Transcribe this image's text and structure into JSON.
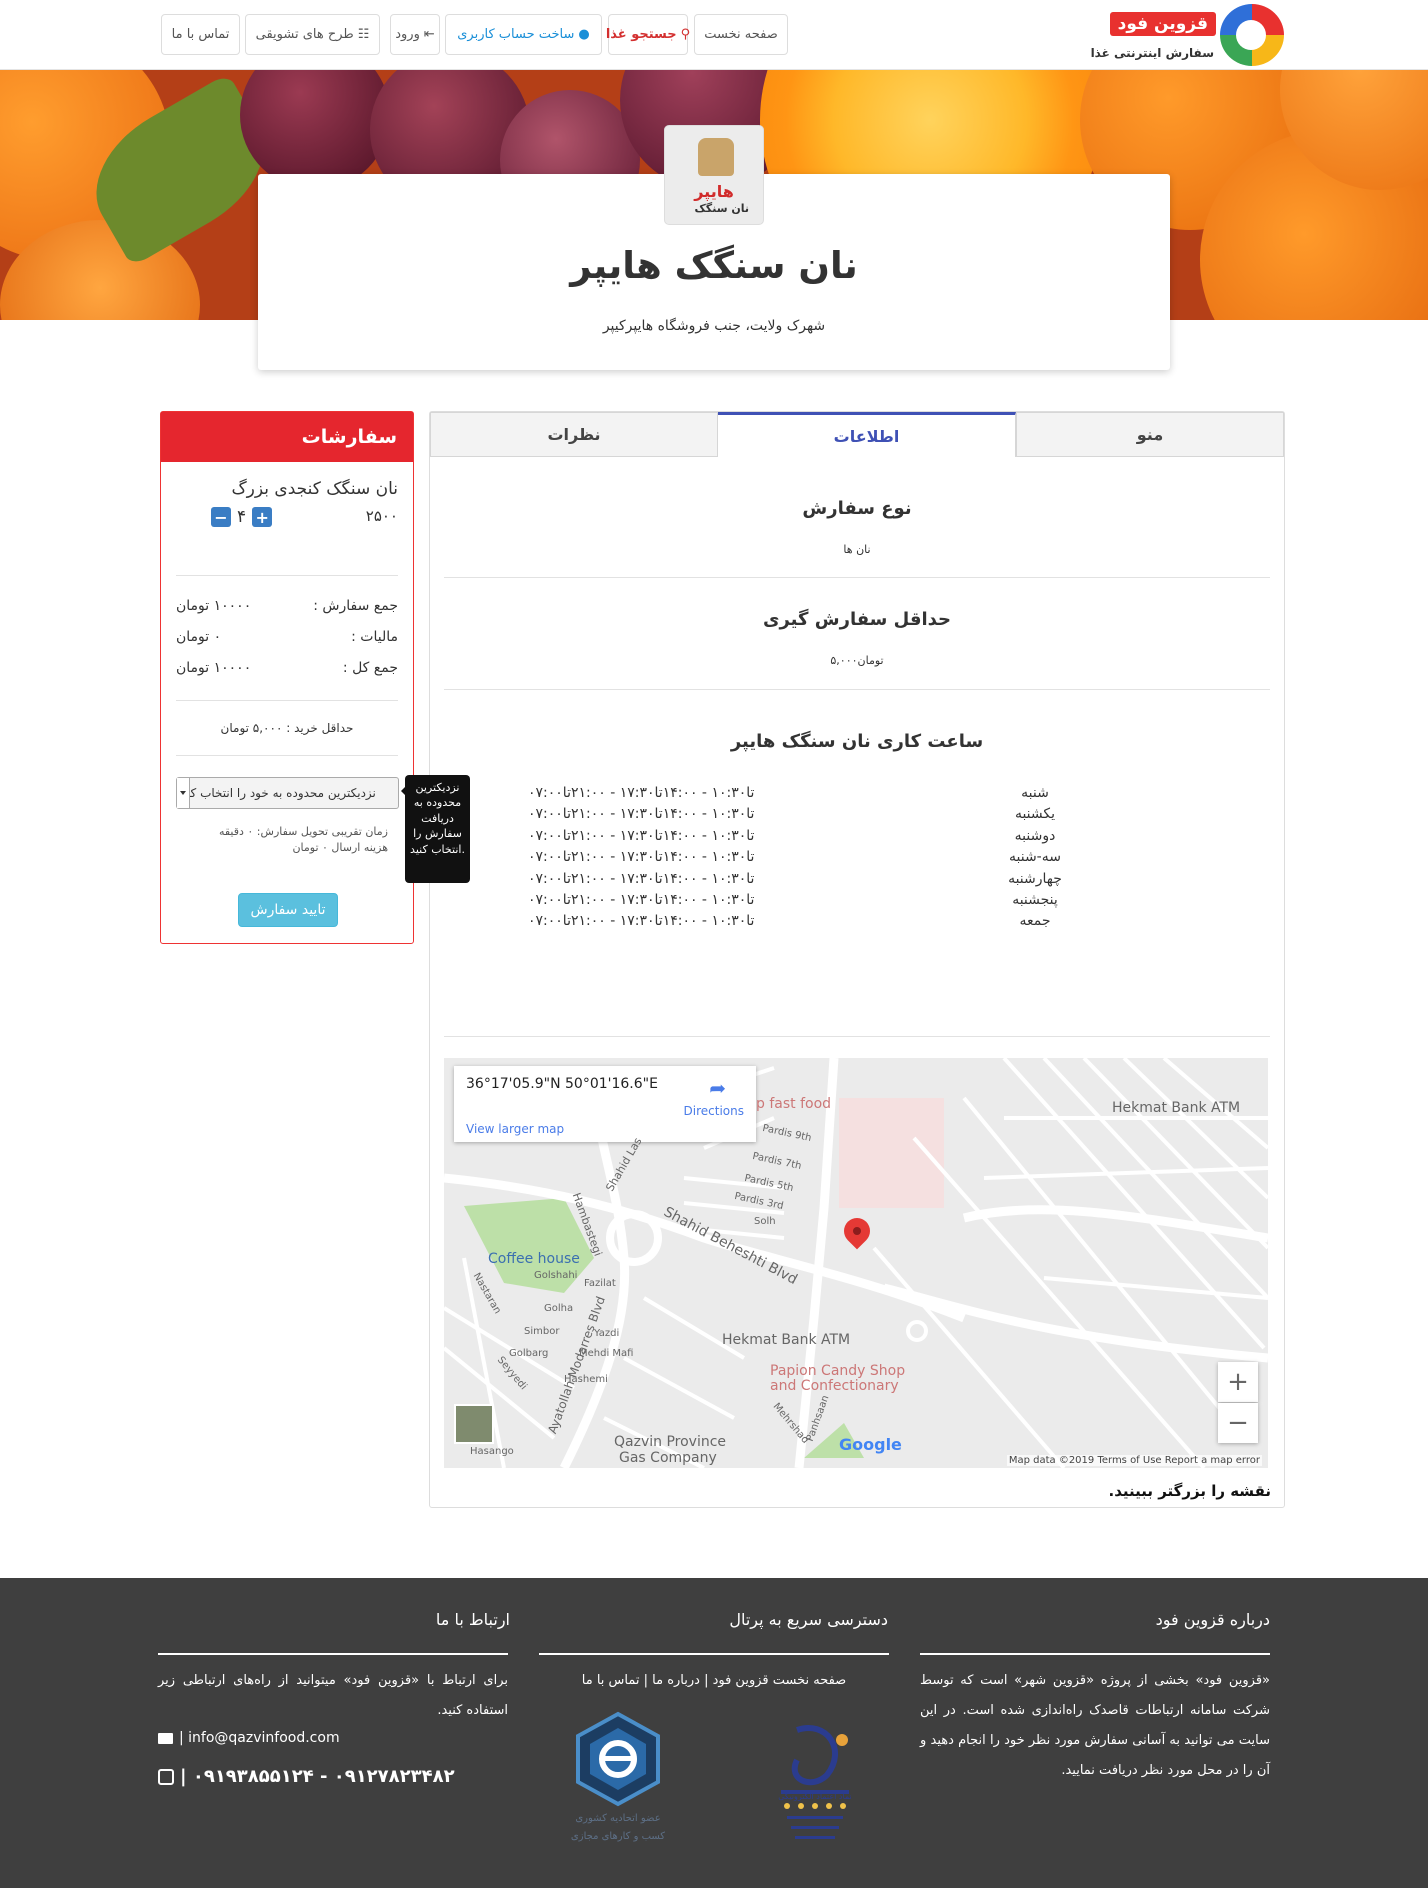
{
  "navbar": {
    "logo_main": "قزوین فود",
    "logo_sub": "سفارش اینترنتی غذا",
    "items": [
      {
        "label": "صفحه نخست",
        "icon": ""
      },
      {
        "label": "جستجو غذا",
        "icon": "search-icon"
      },
      {
        "label": "ساخت حساب کاربری",
        "icon": "user-icon"
      },
      {
        "label": "ورود",
        "icon": "sign-in-icon"
      },
      {
        "label": "طرح های تشویقی",
        "icon": "gift-icon"
      },
      {
        "label": "تماس با ما",
        "icon": ""
      }
    ]
  },
  "shop": {
    "logo_text_red": "هایپر",
    "logo_text_black": "نان سنگک",
    "title": "نان سنگک هایپر",
    "address": "شهرک ولایت، جنب فروشگاه هایپرکیپر"
  },
  "tabs": [
    {
      "label": "منو",
      "active": false
    },
    {
      "label": "اطلاعات",
      "active": true
    },
    {
      "label": "نظرات",
      "active": false
    }
  ],
  "info": {
    "order_type_title": "نوع سفارش",
    "order_type_value": "نان ها",
    "min_order_title": "حداقل سفارش گیری",
    "min_order_value": "۵,۰۰۰تومان",
    "hours_title": "ساعت کاری نان سنگک هایپر",
    "hours": [
      {
        "day": "شنبه",
        "time": "۰۷:۰۰تا۱۰:۳۰ - ۱۴:۰۰تا۱۷:۳۰ - ۲۱:۰۰تا"
      },
      {
        "day": "یکشنبه",
        "time": "۰۷:۰۰تا۱۰:۳۰ - ۱۴:۰۰تا۱۷:۳۰ - ۲۱:۰۰تا"
      },
      {
        "day": "دوشنبه",
        "time": "۰۷:۰۰تا۱۰:۳۰ - ۱۴:۰۰تا۱۷:۳۰ - ۲۱:۰۰تا"
      },
      {
        "day": "سه-شنبه",
        "time": "۰۷:۰۰تا۱۰:۳۰ - ۱۴:۰۰تا۱۷:۳۰ - ۲۱:۰۰تا"
      },
      {
        "day": "چهارشنبه",
        "time": "۰۷:۰۰تا۱۰:۳۰ - ۱۴:۰۰تا۱۷:۳۰ - ۲۱:۰۰تا"
      },
      {
        "day": "پنجشنبه",
        "time": "۰۷:۰۰تا۱۰:۳۰ - ۱۴:۰۰تا۱۷:۳۰ - ۲۱:۰۰تا"
      },
      {
        "day": "جمعه",
        "time": "۰۷:۰۰تا۱۰:۳۰ - ۱۴:۰۰تا۱۷:۳۰ - ۲۱:۰۰تا"
      }
    ]
  },
  "map": {
    "coords": "36°17'05.9\"N 50°01'16.6\"E",
    "directions": "Directions",
    "view_larger": "View larger map",
    "footer": "Map data ©2019    Terms of Use    Report a map error",
    "labels": [
      "Hekmat Bank ATM",
      "p fast food",
      "Pardis 9th",
      "Pardis 7th",
      "Pardis 5th",
      "Pardis 3rd",
      "Solh",
      "Shahid Las",
      "Hambastegi",
      "Shahid Beheshti Blvd",
      "Coffee house",
      "Golshahi",
      "Fazilat",
      "Nastaran",
      "Golha",
      "Yazdi",
      "Simbor",
      "Golbarg",
      "Mehdi Mafi",
      "Hashemi",
      "Seyyedi",
      "Hasango",
      "Ayatollah Modarres Blvd",
      "Hekmat Bank ATM",
      "Papion Candy Shop",
      "and Confectionary",
      "Qazvin Province",
      "Gas Company",
      "Mehrshad",
      "Panhsaan"
    ],
    "bigger_link": "نقشه را بزرگتر ببینید."
  },
  "orders": {
    "title": "سفارشات",
    "item_name": "نان سنگک کنجدی بزرگ",
    "item_price": "۲۵۰۰",
    "item_qty": "۴",
    "subtotal_label": "جمع سفارش :",
    "subtotal_value": "۱۰۰۰۰ تومان",
    "tax_label": "مالیات :",
    "tax_value": "۰ تومان",
    "total_label": "جمع کل :",
    "total_value": "۱۰۰۰۰ تومان",
    "min_buy": "حداقل خرید : ۵,۰۰۰ تومان",
    "area_placeholder": "نزدیکترین محدوده به خود را انتخاب کنید",
    "tooltip": "نزدیکترین محدوده به دریافت سفارش را انتخاب کنید.",
    "delivery_time": "زمان تقریبی تحویل سفارش: ۰ دقیقه",
    "delivery_cost": "هزینه ارسال ۰ تومان",
    "confirm": "تایید سفارش"
  },
  "footer": {
    "about_title": "درباره قزوین فود",
    "about_text": "«قزوین فود» بخشی از پروژه «قزوین شهر» است که توسط شرکت سامانه ارتباطات قاصدک راه‌اندازی شده است. در این سایت می توانید به آسانی سفارش مورد نظر خود را انجام دهید و آن را در محل مورد نظر دریافت نمایید.",
    "quick_title": "دسترسی سریع به پرتال",
    "quick_links": "صفحه نخست قزوین فود | درباره ما | تماس با ما",
    "contact_title": "ارتباط با ما",
    "contact_text": "برای ارتباط با «قزوین فود» میتوانید از راه‌های ارتباطی زیر استفاده کنید.",
    "email": "| info@qazvinfood.com",
    "phones": "۰۹۱۲۷۸۲۳۴۸۲ - ۰۹۱۹۳۸۵۵۱۲۴ |",
    "badge1_text": "نماد اعتماد الکترونیکی",
    "badge2_text": "عضو اتحادیه کشوری کسب و کارهای مجازی"
  },
  "colors": {
    "accent_red": "#e5262e",
    "tab_active": "#3f51b5",
    "confirm_blue": "#5bc0de",
    "footer_bg": "#3f3f3f"
  }
}
